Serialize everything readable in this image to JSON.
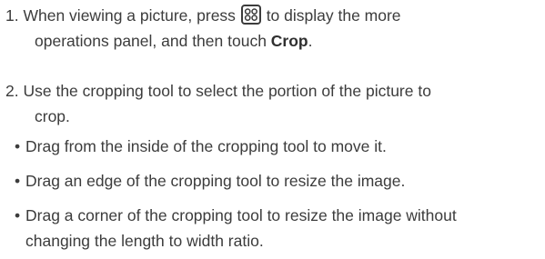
{
  "step1": {
    "num": "1.",
    "line1_before": "When viewing a picture, press",
    "line1_after": "to display the more",
    "line2_before": "operations panel, and then touch",
    "line2_bold": "Crop",
    "line2_after": ".",
    "icon": "more-operations-icon"
  },
  "step2": {
    "num": "2.",
    "line1": "Use the cropping tool to select the portion of the picture to",
    "line2": "crop."
  },
  "bullets": {
    "b1": "Drag from the inside of the cropping tool to move it.",
    "b2": "Drag an edge of the cropping tool to resize the image.",
    "b3_line1": "Drag a corner of the cropping tool to resize the image without",
    "b3_line2": "changing the length to width ratio."
  }
}
